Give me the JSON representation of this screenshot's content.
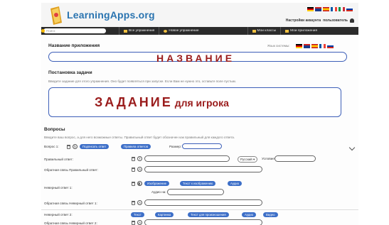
{
  "header": {
    "logo_text": "LearningApps.org",
    "user_text": "Настройки аккаунта",
    "user_name": "пользователь"
  },
  "nav": {
    "search_placeholder": "Поиск",
    "items": [
      "Все упражнения",
      "Новое упражнение",
      "Мои классы",
      "Мои приложения"
    ]
  },
  "app_name": {
    "heading": "Название приложения",
    "lang_label": "Язык системы:",
    "value": "НАЗВАНИЕ"
  },
  "task": {
    "heading": "Постановка задачи",
    "hint": "Введите задание для этого упражнения. Оно будет появляться при запуске. Если Вам не нужно это, оставьте поле пустым.",
    "value_main": "ЗАДАНИЕ",
    "value_rest": "для игрока"
  },
  "questions": {
    "heading": "Вопросы",
    "hint": "Введите ваш вопрос, а для него возможные ответы. Правильный ответ будет обозначен как правильный для каждого ответа.",
    "q_label": "Вопрос 1:",
    "q_btn_text": "Подписать ответ",
    "q_btn_more": "Правила ответов",
    "q_score_label": "Размер:",
    "correct_label": "Правильный ответ:",
    "lang_select": "Русский",
    "cond_label": "Условие:",
    "feedback_correct": "Обратная связь Правильный ответ:",
    "wrong1_label": "Неверный ответ 1:",
    "wrong1_btns": [
      "Изображение",
      "Текст к изображению",
      "Аудио"
    ],
    "wrong1_sub": "Аудио на:",
    "feedback_wrong1": "Обратная связь Неверный ответ 1:",
    "wrong2_label": "Неверный ответ 2:",
    "wrong2_btns": [
      "Текст",
      "Картинка",
      "Текст для произношения",
      "Аудио",
      "Видео"
    ],
    "feedback_wrong2": "Обратная связь Неверный ответ 2:"
  },
  "colors": {
    "accent": "#3d5fb8",
    "title_red": "#9a1c1c",
    "nav_bg": "#2b2b2b"
  }
}
